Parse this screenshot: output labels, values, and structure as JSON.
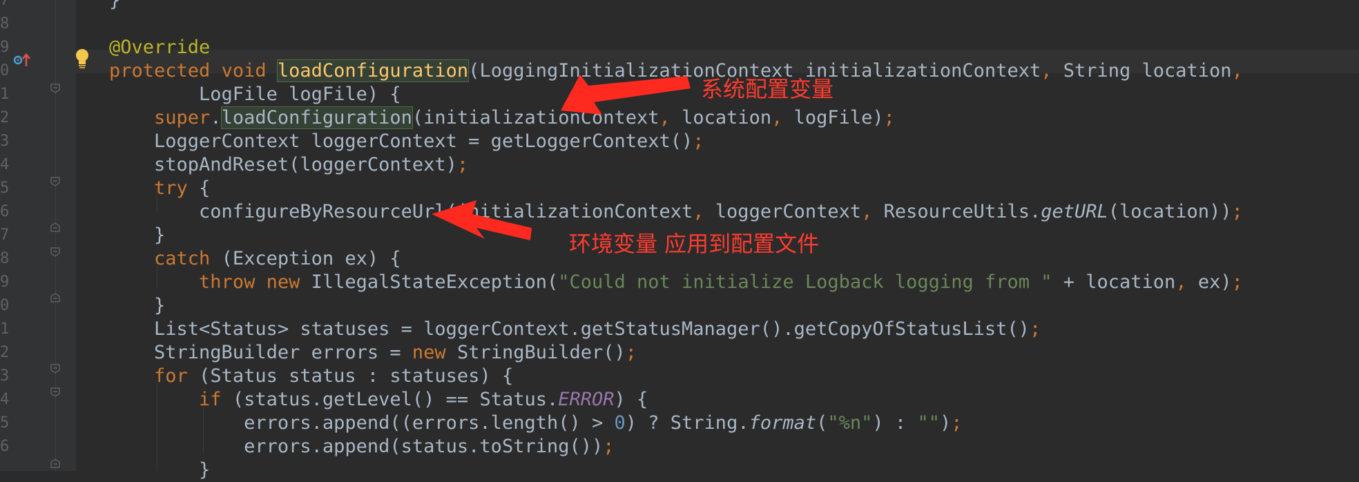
{
  "editor": {
    "line_numbers": [
      "7",
      "8",
      "9",
      "0",
      "1",
      "2",
      "3",
      "4",
      "5",
      "6",
      "7",
      "8",
      "9",
      "0",
      "1",
      "2",
      "3",
      "4",
      "5",
      "6"
    ],
    "lines": [
      {
        "tokens": [
          {
            "t": "}",
            "c": ""
          }
        ]
      },
      {
        "tokens": []
      },
      {
        "tokens": [
          {
            "t": "@Override",
            "c": "ann"
          }
        ]
      },
      {
        "tokens": [
          {
            "t": "protected ",
            "c": "kw"
          },
          {
            "t": "void ",
            "c": "kw"
          },
          {
            "t": "loadConfiguration",
            "c": "fn hl"
          },
          {
            "t": "(LoggingInitializationContext initializationContext",
            "c": ""
          },
          {
            "t": ", ",
            "c": "kw"
          },
          {
            "t": "String location",
            "c": ""
          },
          {
            "t": ",",
            "c": "kw"
          }
        ]
      },
      {
        "tokens": [
          {
            "t": "        LogFile logFile) {",
            "c": ""
          }
        ]
      },
      {
        "tokens": [
          {
            "t": "    ",
            "c": ""
          },
          {
            "t": "super",
            "c": "kw"
          },
          {
            "t": ".",
            "c": ""
          },
          {
            "t": "loadConfiguration",
            "c": "hl"
          },
          {
            "t": "(initializationContext",
            "c": ""
          },
          {
            "t": ", ",
            "c": "kw"
          },
          {
            "t": "location",
            "c": ""
          },
          {
            "t": ", ",
            "c": "kw"
          },
          {
            "t": "logFile)",
            "c": ""
          },
          {
            "t": ";",
            "c": "kw"
          }
        ]
      },
      {
        "tokens": [
          {
            "t": "    LoggerContext loggerContext = getLoggerContext()",
            "c": ""
          },
          {
            "t": ";",
            "c": "kw"
          }
        ]
      },
      {
        "tokens": [
          {
            "t": "    stopAndReset(loggerContext)",
            "c": ""
          },
          {
            "t": ";",
            "c": "kw"
          }
        ]
      },
      {
        "tokens": [
          {
            "t": "    ",
            "c": ""
          },
          {
            "t": "try ",
            "c": "kw"
          },
          {
            "t": "{",
            "c": ""
          }
        ]
      },
      {
        "tokens": [
          {
            "t": "        configureByResourceUrl(initializationContext",
            "c": ""
          },
          {
            "t": ", ",
            "c": "kw"
          },
          {
            "t": "loggerContext",
            "c": ""
          },
          {
            "t": ", ",
            "c": "kw"
          },
          {
            "t": "ResourceUtils.",
            "c": ""
          },
          {
            "t": "getURL",
            "c": "ital"
          },
          {
            "t": "(location))",
            "c": ""
          },
          {
            "t": ";",
            "c": "kw"
          }
        ]
      },
      {
        "tokens": [
          {
            "t": "    }",
            "c": ""
          }
        ]
      },
      {
        "tokens": [
          {
            "t": "    ",
            "c": ""
          },
          {
            "t": "catch ",
            "c": "kw"
          },
          {
            "t": "(Exception ex) {",
            "c": ""
          }
        ]
      },
      {
        "tokens": [
          {
            "t": "        ",
            "c": ""
          },
          {
            "t": "throw ",
            "c": "kw"
          },
          {
            "t": "new ",
            "c": "kw"
          },
          {
            "t": "IllegalStateException(",
            "c": ""
          },
          {
            "t": "\"Could not initialize Logback logging from \"",
            "c": "str"
          },
          {
            "t": " + location",
            "c": ""
          },
          {
            "t": ", ",
            "c": "kw"
          },
          {
            "t": "ex)",
            "c": ""
          },
          {
            "t": ";",
            "c": "kw"
          }
        ]
      },
      {
        "tokens": [
          {
            "t": "    }",
            "c": ""
          }
        ]
      },
      {
        "tokens": [
          {
            "t": "    List<Status> statuses = loggerContext.getStatusManager().getCopyOfStatusList()",
            "c": ""
          },
          {
            "t": ";",
            "c": "kw"
          }
        ]
      },
      {
        "tokens": [
          {
            "t": "    StringBuilder errors = ",
            "c": ""
          },
          {
            "t": "new ",
            "c": "kw"
          },
          {
            "t": "StringBuilder()",
            "c": ""
          },
          {
            "t": ";",
            "c": "kw"
          }
        ]
      },
      {
        "tokens": [
          {
            "t": "    ",
            "c": ""
          },
          {
            "t": "for ",
            "c": "kw"
          },
          {
            "t": "(Status status : statuses) {",
            "c": ""
          }
        ]
      },
      {
        "tokens": [
          {
            "t": "        ",
            "c": ""
          },
          {
            "t": "if ",
            "c": "kw"
          },
          {
            "t": "(status.getLevel() == Status.",
            "c": ""
          },
          {
            "t": "ERROR",
            "c": "static"
          },
          {
            "t": ") {",
            "c": ""
          }
        ]
      },
      {
        "tokens": [
          {
            "t": "            errors.append((errors.length() > ",
            "c": ""
          },
          {
            "t": "0",
            "c": "num"
          },
          {
            "t": ") ? String.",
            "c": ""
          },
          {
            "t": "format",
            "c": "ital"
          },
          {
            "t": "(",
            "c": ""
          },
          {
            "t": "\"%n\"",
            "c": "str"
          },
          {
            "t": ") : ",
            "c": ""
          },
          {
            "t": "\"\"",
            "c": "str"
          },
          {
            "t": ")",
            "c": ""
          },
          {
            "t": ";",
            "c": "kw"
          }
        ]
      },
      {
        "tokens": [
          {
            "t": "            errors.append(status.toString())",
            "c": ""
          },
          {
            "t": ";",
            "c": "kw"
          }
        ]
      },
      {
        "tokens": [
          {
            "t": "        }",
            "c": ""
          }
        ]
      }
    ]
  },
  "annotations": {
    "system_config_vars": "系统配置变量",
    "env_vars_applied": "环境变量 应用到配置文件"
  },
  "colors": {
    "background": "#2b2b2b",
    "keyword": "#cc7832",
    "annotation": "#bbb529",
    "string": "#6a8759",
    "arrow": "#ff2a1f"
  },
  "icons": {
    "intention": "lightbulb-icon",
    "override_marker": "override-method-icon"
  }
}
